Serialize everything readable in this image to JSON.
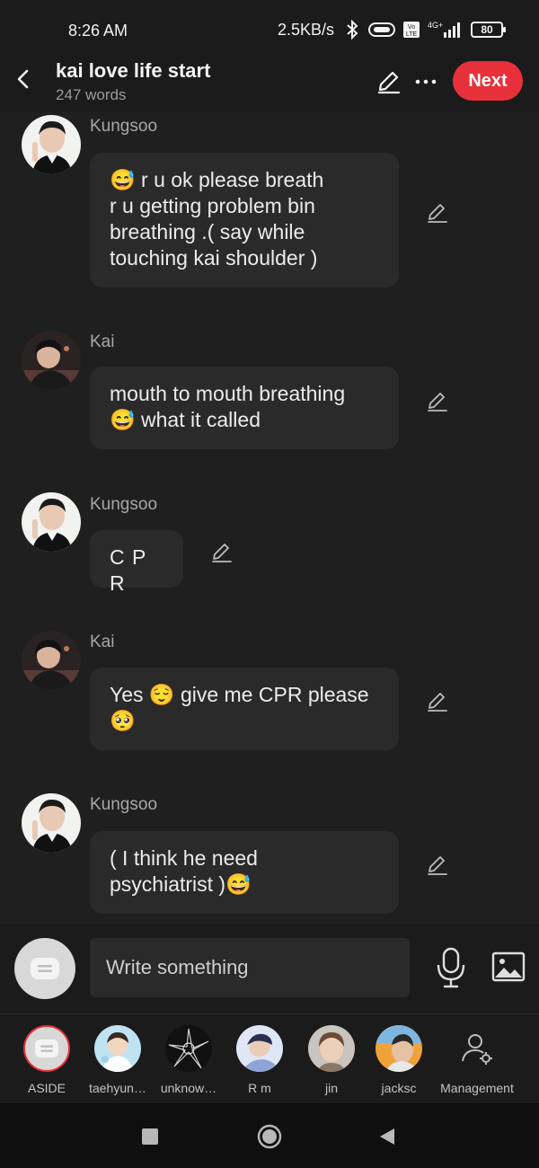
{
  "status_bar": {
    "time": "8:26 AM",
    "speed": "2.5KB/s",
    "network": "4G+",
    "volte": "Vo LTE",
    "battery": "80",
    "icons": [
      "bluetooth-icon",
      "hotspot-icon",
      "volte-icon",
      "signal-icon",
      "battery-icon"
    ]
  },
  "header": {
    "title": "kai love life start",
    "subtitle": "247 words",
    "next_label": "Next"
  },
  "messages": [
    {
      "sender": "Kungsoo",
      "lines": [
        "😅 r u ok please breath",
        "r u getting problem bin",
        "breathing .( say while",
        "touching kai shoulder )"
      ]
    },
    {
      "sender": "Kai",
      "lines": [
        "mouth to mouth breathing",
        "😅 what it called"
      ]
    },
    {
      "sender": "Kungsoo",
      "lines": [
        "C P R"
      ]
    },
    {
      "sender": "Kai",
      "lines": [
        "Yes 😌 give me CPR please",
        "🥺"
      ]
    },
    {
      "sender": "Kungsoo",
      "lines": [
        "( I think he need",
        "psychiatrist )😅"
      ]
    }
  ],
  "input": {
    "placeholder": "Write something"
  },
  "characters": [
    {
      "label": "ASIDE",
      "icon": "aside-icon"
    },
    {
      "label": "taehyun…"
    },
    {
      "label": "unknow…"
    },
    {
      "label": "R m"
    },
    {
      "label": "jin"
    },
    {
      "label": "jacksc"
    },
    {
      "label": "Management",
      "icon": "user-settings-icon"
    }
  ],
  "colors": {
    "accent": "#e8303b",
    "background": "#1f1f1f",
    "bubble": "#2a2a2a"
  }
}
